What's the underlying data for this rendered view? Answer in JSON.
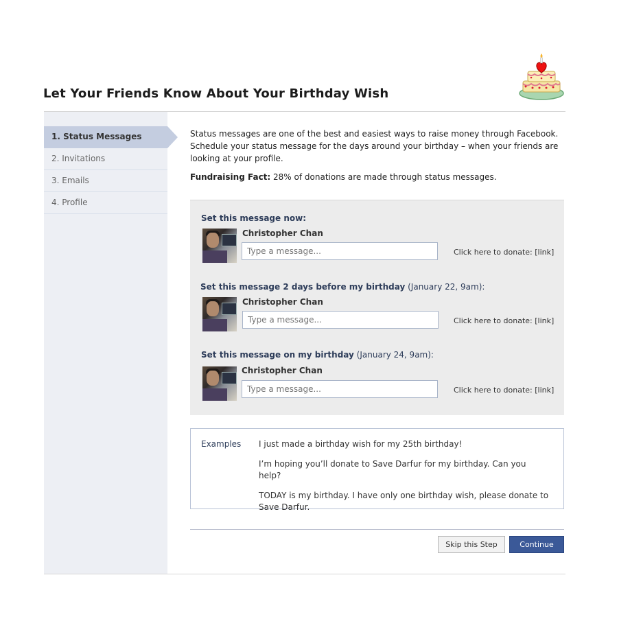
{
  "page": {
    "title": "Let Your Friends Know About Your Birthday Wish"
  },
  "sidebar": {
    "items": [
      {
        "label": "1. Status Messages",
        "active": true
      },
      {
        "label": "2. Invitations",
        "active": false
      },
      {
        "label": "3. Emails",
        "active": false
      },
      {
        "label": "4. Profile",
        "active": false
      }
    ]
  },
  "intro": {
    "text": "Status messages are one of the best and easiest ways to raise money through Facebook. Schedule your status message for the days around your birthday – when your friends are looking at your profile.",
    "fact_label": "Fundraising Fact:",
    "fact_text": " 28% of donations are made through status messages."
  },
  "messages": [
    {
      "heading": "Set this message now:",
      "date": "",
      "user": "Christopher Chan",
      "placeholder": "Type a message...",
      "donate": "Click here to donate: [link]"
    },
    {
      "heading": "Set this message 2 days before my birthday",
      "date": " (January 22, 9am):",
      "user": "Christopher Chan",
      "placeholder": "Type a message...",
      "donate": "Click here to donate: [link]"
    },
    {
      "heading": "Set this message on my birthday",
      "date": " (January 24, 9am):",
      "user": "Christopher Chan",
      "placeholder": "Type a message...",
      "donate": "Click here to donate: [link]"
    }
  ],
  "examples": {
    "label": "Examples",
    "items": [
      "I just made a birthday wish for my 25th birthday!",
      "I’m hoping you’ll donate to Save Darfur for my birthday. Can you help?",
      "TODAY is my birthday. I have only one birthday wish, please donate to Save Darfur."
    ]
  },
  "actions": {
    "skip_label": "Skip this Step",
    "continue_label": "Continue"
  },
  "icons": {
    "header": "birthday-cake-icon",
    "avatar": "user-profile-photo"
  },
  "colors": {
    "sidebar_bg": "#edeff4",
    "nav_active": "#c4cde0",
    "heading_text": "#2e3d5a",
    "primary_button": "#3b5998",
    "panel_bg": "#ececec"
  }
}
